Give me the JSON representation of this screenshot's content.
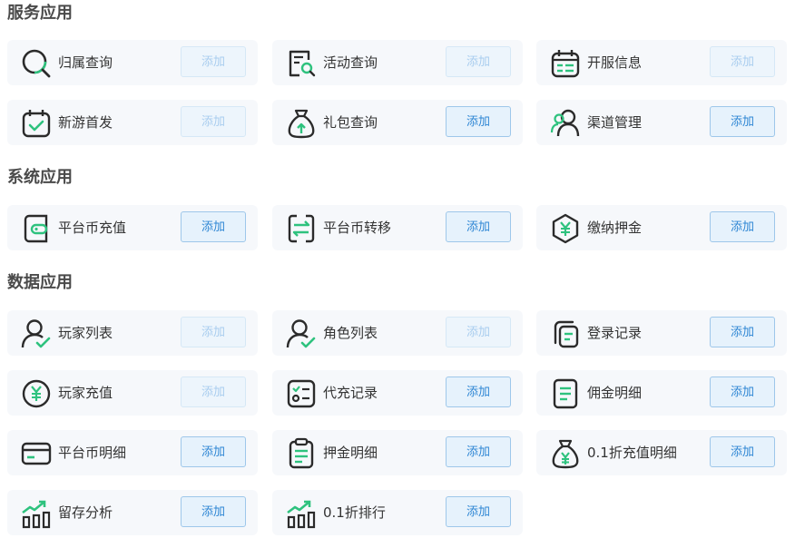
{
  "sections": [
    {
      "title": "服务应用",
      "items": [
        {
          "label": "归属查询",
          "icon": "magnifier-icon",
          "button": "添加",
          "disabled": true
        },
        {
          "label": "活动查询",
          "icon": "document-search-icon",
          "button": "添加",
          "disabled": true
        },
        {
          "label": "开服信息",
          "icon": "calendar-icon",
          "button": "添加",
          "disabled": true
        },
        {
          "label": "新游首发",
          "icon": "calendar-check-icon",
          "button": "添加",
          "disabled": true
        },
        {
          "label": "礼包查询",
          "icon": "money-bag-icon",
          "button": "添加",
          "disabled": false
        },
        {
          "label": "渠道管理",
          "icon": "users-icon",
          "button": "添加",
          "disabled": false
        }
      ]
    },
    {
      "title": "系统应用",
      "items": [
        {
          "label": "平台币充值",
          "icon": "wallet-icon",
          "button": "添加",
          "disabled": false
        },
        {
          "label": "平台币转移",
          "icon": "transfer-icon",
          "button": "添加",
          "disabled": false
        },
        {
          "label": "缴纳押金",
          "icon": "yuan-hexagon-icon",
          "button": "添加",
          "disabled": false
        }
      ]
    },
    {
      "title": "数据应用",
      "items": [
        {
          "label": "玩家列表",
          "icon": "user-check-icon",
          "button": "添加",
          "disabled": true
        },
        {
          "label": "角色列表",
          "icon": "user-check-icon",
          "button": "添加",
          "disabled": true
        },
        {
          "label": "登录记录",
          "icon": "copy-document-icon",
          "button": "添加",
          "disabled": false
        },
        {
          "label": "玩家充值",
          "icon": "yuan-circle-icon",
          "button": "添加",
          "disabled": true
        },
        {
          "label": "代充记录",
          "icon": "checklist-icon",
          "button": "添加",
          "disabled": false
        },
        {
          "label": "佣金明细",
          "icon": "document-lines-icon",
          "button": "添加",
          "disabled": false
        },
        {
          "label": "平台币明细",
          "icon": "card-icon",
          "button": "添加",
          "disabled": false
        },
        {
          "label": "押金明细",
          "icon": "clipboard-icon",
          "button": "添加",
          "disabled": false
        },
        {
          "label": "0.1折充值明细",
          "icon": "money-bag-yuan-icon",
          "button": "添加",
          "disabled": false
        },
        {
          "label": "留存分析",
          "icon": "bar-chart-icon",
          "button": "添加",
          "disabled": false
        },
        {
          "label": "0.1折排行",
          "icon": "bar-chart-icon",
          "button": "添加",
          "disabled": false
        }
      ]
    }
  ],
  "colors": {
    "icon_stroke": "#2b2b2b",
    "icon_accent": "#2ec27e",
    "button_text": "#2e86d4",
    "button_bg": "#e6f2fc",
    "button_border": "#9ec7ea",
    "card_bg": "#f6f8fb"
  }
}
